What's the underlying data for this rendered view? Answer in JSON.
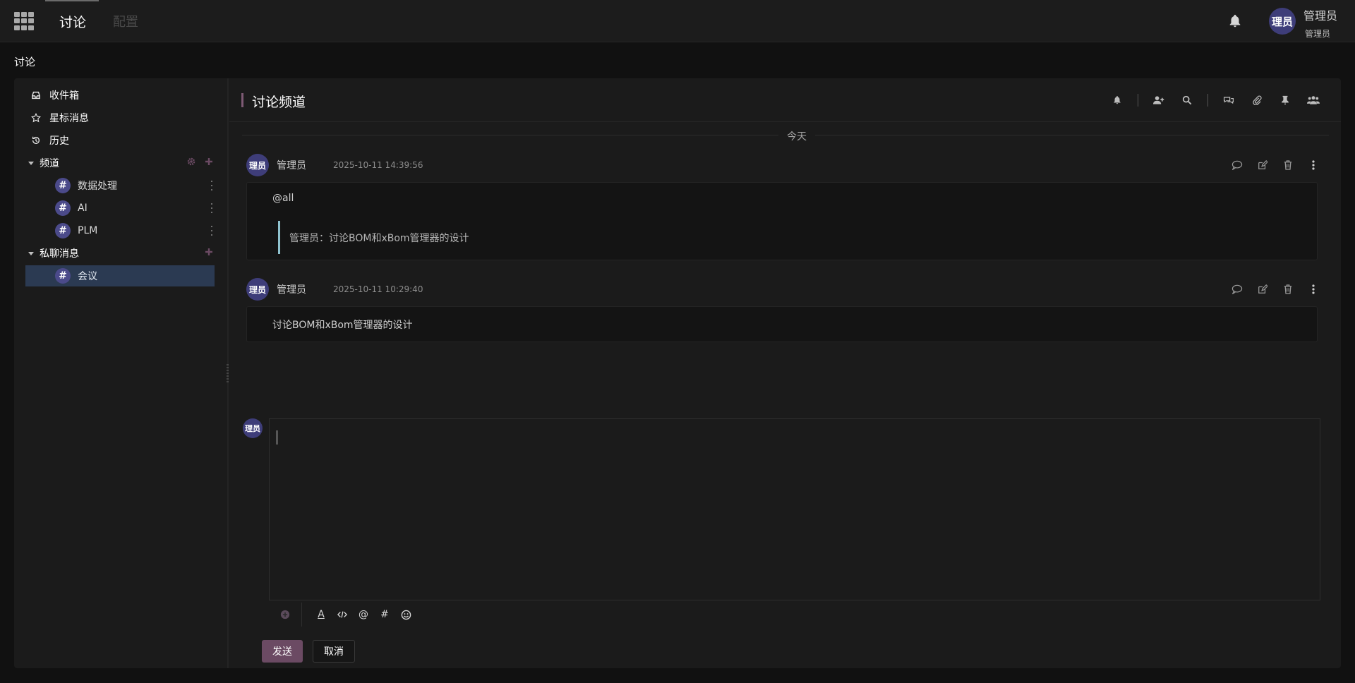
{
  "topbar": {
    "menu_discuss": "讨论",
    "menu_config": "配置",
    "user_avatar_text": "理员",
    "user_name": "管理员",
    "user_company": "管理员"
  },
  "breadcrumb": "讨论",
  "sidebar": {
    "inbox": "收件箱",
    "starred": "星标消息",
    "history": "历史",
    "channels_header": "频道",
    "channels": [
      {
        "label": "数据处理"
      },
      {
        "label": "AI"
      },
      {
        "label": "PLM"
      }
    ],
    "dm_header": "私聊消息",
    "direct_messages": [
      {
        "label": "会议"
      }
    ]
  },
  "thread": {
    "title": "讨论频道",
    "day_label": "今天",
    "messages": [
      {
        "avatar": "理员",
        "author": "管理员",
        "time": "2025-10-11 14:39:56",
        "body": "@all",
        "quote": "管理员：讨论BOM和xBom管理器的设计"
      },
      {
        "avatar": "理员",
        "author": "管理员",
        "time": "2025-10-11 10:29:40",
        "body": "讨论BOM和xBom管理器的设计"
      }
    ]
  },
  "composer": {
    "avatar": "理员",
    "send_label": "发送",
    "cancel_label": "取消",
    "mention_symbol": "@",
    "channel_symbol": "#",
    "font_symbol": "A"
  },
  "colors": {
    "accent": "#6b4a63",
    "avatar": "#3e3d79",
    "active_channel": "#2b3a52",
    "quote_bar": "#8fc2cf"
  }
}
